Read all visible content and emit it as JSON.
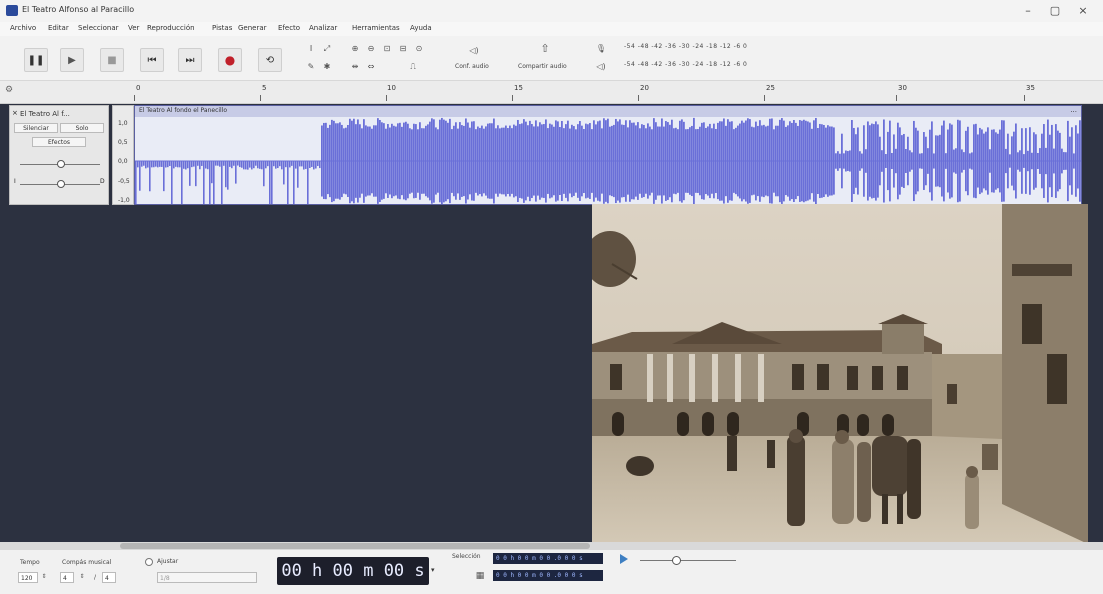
{
  "window": {
    "title": "El Teatro Alfonso al Paracillo",
    "controls": [
      "–",
      "▢",
      "×"
    ]
  },
  "menu": [
    "Archivo",
    "Editar",
    "Seleccionar",
    "Ver",
    "Reproducción",
    "Pistas",
    "Generar",
    "Efecto",
    "Analizar",
    "Herramientas",
    "Ayuda"
  ],
  "toolbar": {
    "transport": [
      "pause-icon",
      "play-icon",
      "stop-icon",
      "skip-start-icon",
      "skip-end-icon",
      "record-icon",
      "loop-icon"
    ],
    "audio_setup_label": "Conf. audio",
    "share_audio_label": "Compartir audio",
    "meter_ticks": "-54 -48 -42 -36 -30 -24 -18 -12 -6 0"
  },
  "ruler": {
    "ticks": [
      "0",
      "5",
      "10",
      "15",
      "20",
      "25",
      "30",
      "35"
    ]
  },
  "track": {
    "name": "El Teatro Al f...",
    "mute_label": "Silenciar",
    "solo_label": "Solo",
    "effects_label": "Efectos",
    "pan_left": "I",
    "pan_right": "D",
    "clip_name": "El Teatro Al fondo el Panecillo",
    "clip_menu": "...",
    "scale": [
      "1,0",
      "0,5",
      "0,0",
      "-0,5",
      "-1,0"
    ],
    "waveform_color": "#6a6fd8"
  },
  "bottom": {
    "tempo_label": "Tempo",
    "tempo_value": "120",
    "time_signature_label": "Compás musical",
    "time_sig_top": "4",
    "time_sig_bottom": "4",
    "snap_label": "Ajustar",
    "snap_value": "1/8",
    "timecode": "00 h 00 m 00 s",
    "selection_label": "Selección",
    "selection_start": "0 0 h 0 0 m 0 0 .0 0 0 s",
    "selection_end": "0 0 h 0 0 m 0 0 .0 0 0 s"
  },
  "photo": {
    "description_alt": "sepia-street-photo"
  }
}
